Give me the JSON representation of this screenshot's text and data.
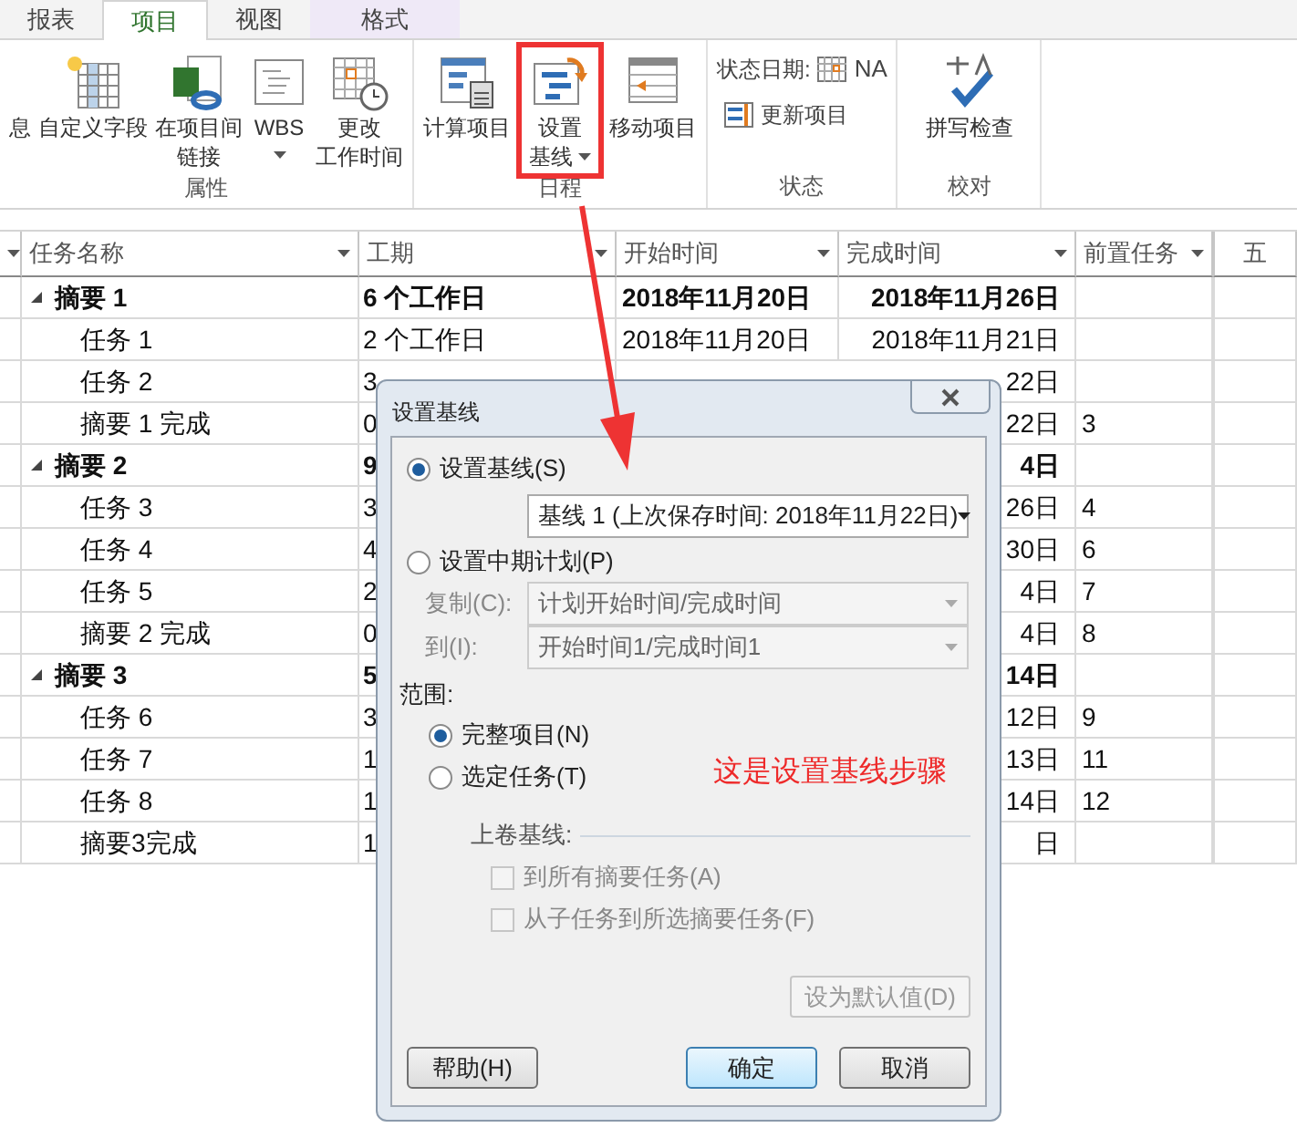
{
  "ribbon": {
    "tabs": [
      {
        "label": "报表",
        "selected": false,
        "kind": "normal"
      },
      {
        "label": "项目",
        "selected": true,
        "kind": "normal"
      },
      {
        "label": "视图",
        "selected": false,
        "kind": "normal"
      },
      {
        "label": "格式",
        "selected": false,
        "kind": "contextual"
      }
    ],
    "groups": [
      {
        "kind": "large",
        "label": "属性",
        "buttons": [
          {
            "lines": [
              "息"
            ]
          },
          {
            "lines": [
              "自定义字段"
            ]
          },
          {
            "lines": [
              "在项目间",
              "链接"
            ]
          },
          {
            "lines": [
              "WBS"
            ],
            "dropdown": true
          },
          {
            "lines": [
              "更改",
              "工作时间"
            ]
          }
        ]
      },
      {
        "kind": "large",
        "label": "日程",
        "buttons": [
          {
            "lines": [
              "计算项目"
            ]
          },
          {
            "lines": [
              "设置",
              "基线"
            ],
            "dropdown": true,
            "highlighted": true
          },
          {
            "lines": [
              "移动项目"
            ]
          }
        ]
      },
      {
        "kind": "status",
        "label": "状态",
        "status_date": {
          "label": "状态日期:",
          "value": "NA"
        },
        "buttons": [
          {
            "lines": [
              "更新项目"
            ]
          }
        ]
      },
      {
        "kind": "large",
        "label": "校对",
        "buttons": [
          {
            "lines": [
              "拼写检查"
            ]
          }
        ]
      }
    ]
  },
  "table": {
    "columns": [
      "任务名称",
      "工期",
      "开始时间",
      "完成时间",
      "前置任务"
    ],
    "timeline_header": "五",
    "rows": [
      {
        "name": "摘要 1",
        "expanded": true,
        "duration": "6 个工作日",
        "start": "2018年11月20日",
        "finish": "2018年11月26日",
        "children": [
          {
            "name": "任务 1",
            "duration": "2 个工作日",
            "start": "2018年11月20日",
            "finish": "2018年11月21日"
          },
          {
            "name": "任务 2",
            "duration": "3",
            "finish": "22日"
          },
          {
            "name": "摘要 1 完成",
            "duration": "0",
            "finish": "22日",
            "predecessor": "3"
          }
        ]
      },
      {
        "name": "摘要 2",
        "expanded": true,
        "duration": "9",
        "finish": "4日",
        "children": [
          {
            "name": "任务 3",
            "duration": "3",
            "finish": "26日",
            "predecessor": "4"
          },
          {
            "name": "任务 4",
            "duration": "4",
            "finish": "30日",
            "predecessor": "6"
          },
          {
            "name": "任务 5",
            "duration": "2",
            "finish": "4日",
            "predecessor": "7"
          },
          {
            "name": "摘要 2 完成",
            "duration": "0",
            "finish": "4日",
            "predecessor": "8"
          }
        ]
      },
      {
        "name": "摘要 3",
        "expanded": true,
        "duration": "5",
        "finish": "14日",
        "children": [
          {
            "name": "任务 6",
            "duration": "3",
            "finish": "12日",
            "predecessor": "9"
          },
          {
            "name": "任务 7",
            "duration": "1",
            "finish": "13日",
            "predecessor": "11"
          },
          {
            "name": "任务 8",
            "duration": "1",
            "finish": "14日",
            "predecessor": "12"
          },
          {
            "name": "摘要3完成",
            "duration": "1",
            "finish": "日"
          }
        ]
      }
    ]
  },
  "dialog": {
    "title": "设置基线",
    "options": [
      {
        "label": "设置基线(S)",
        "selected": true
      },
      {
        "label": "设置中期计划(P)",
        "selected": false
      }
    ],
    "baseline_select": {
      "value": "基线 1 (上次保存时间: 2018年11月22日)"
    },
    "copy_field": {
      "label": "复制(C):",
      "value": "计划开始时间/完成时间",
      "disabled": true
    },
    "to_field": {
      "label": "到(I):",
      "value": "开始时间1/完成时间1",
      "disabled": true
    },
    "scope_label": "范围:",
    "scope": [
      {
        "label": "完整项目(N)",
        "selected": true
      },
      {
        "label": "选定任务(T)",
        "selected": false
      }
    ],
    "annotation": "这是设置基线步骤",
    "rollup_label": "上卷基线:",
    "rollup": [
      {
        "label": "到所有摘要任务(A)",
        "checked": false,
        "disabled": true
      },
      {
        "label": "从子任务到所选摘要任务(F)",
        "checked": false,
        "disabled": true
      }
    ],
    "default_button": {
      "label": "设为默认值(D)",
      "disabled": true
    },
    "buttons": [
      {
        "label": "帮助(H)",
        "kind": "normal"
      },
      {
        "label": "确定",
        "kind": "default"
      },
      {
        "label": "取消",
        "kind": "normal"
      }
    ]
  }
}
